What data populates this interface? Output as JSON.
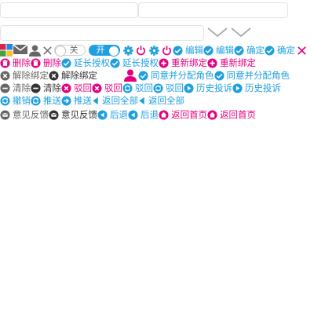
{
  "inputs": {
    "field_1": "",
    "field_2": "",
    "field_3": ""
  },
  "colors": {
    "blue": "#1e9fe0",
    "pink": "#e4007f",
    "gray": "#666666",
    "dark": "#333333",
    "grid_red": "#d9254a",
    "grid_blue": "#1e88e5",
    "grid_green": "#43a047",
    "grid_yellow": "#fbc02d"
  },
  "toggles": {
    "off_label": "关",
    "on_label": "开"
  },
  "labels": {
    "edit": "编辑",
    "confirm": "确定",
    "delete": "删除",
    "extend_auth": "延长授权",
    "rebind": "重新绑定",
    "unbind": "解除绑定",
    "agree_assign_role": "同意并分配角色",
    "clear": "清除",
    "reject": "驳回",
    "history_complaint": "历史投诉",
    "revoke": "撤销",
    "send": "推送",
    "return_all": "返回全部",
    "feedback": "意见反馈",
    "back": "后退",
    "return_home": "返回首页"
  },
  "icons": [
    "grid-icon",
    "mail-icon",
    "user-icon",
    "close-icon",
    "gear-icon",
    "power-icon",
    "check-circle-icon",
    "trash-icon",
    "plus-circle-icon",
    "x-circle-icon",
    "minus-circle-icon",
    "sync-icon",
    "play-circle-icon",
    "arrow-right-circle-icon",
    "caret-left-icon",
    "message-icon",
    "arrow-left-circle-icon",
    "home-icon",
    "chevron-down-icon"
  ]
}
